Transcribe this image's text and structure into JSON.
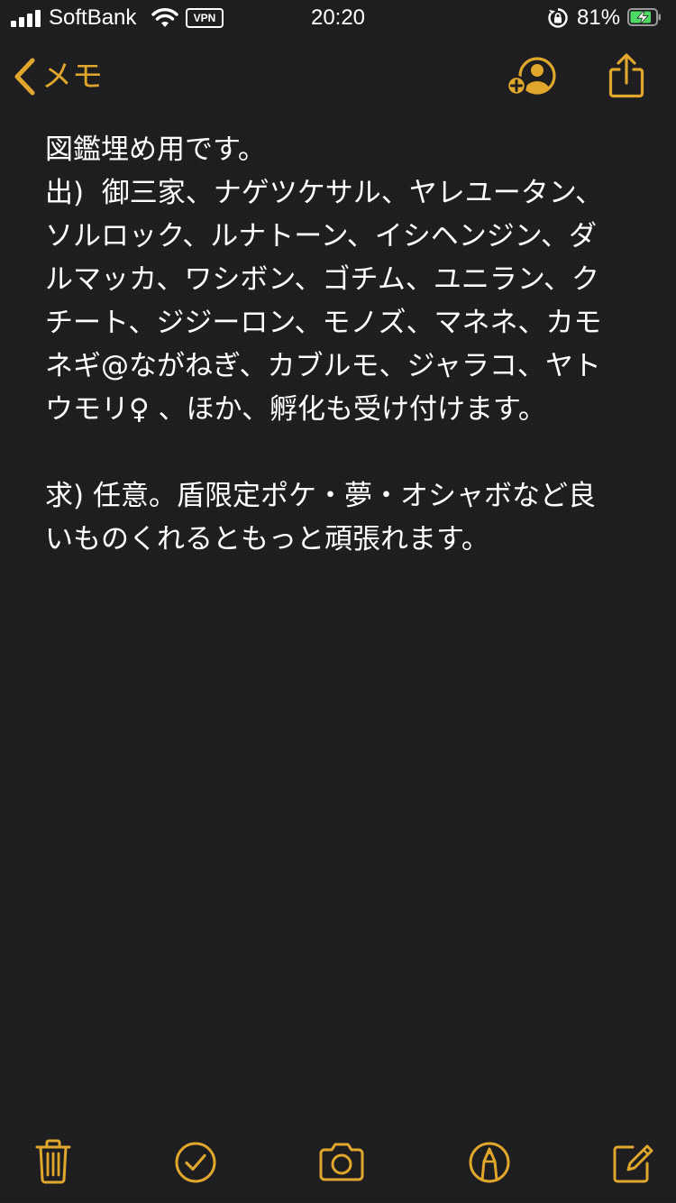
{
  "status_bar": {
    "carrier": "SoftBank",
    "vpn": "VPN",
    "time": "20:20",
    "battery_percent": "81%"
  },
  "nav": {
    "back_label": "メモ",
    "back_icon": "chevron-left-icon",
    "add_person_icon": "add-person-icon",
    "share_icon": "share-icon"
  },
  "note": {
    "lines": [
      "図鑑埋め用です。",
      "出)  御三家、ナゲツケサル、ヤレユータン、",
      "ソルロック、ルナトーン、イシヘンジン、ダ",
      "ルマッカ、ワシボン、ゴチム、ユニラン、ク",
      "チート、ジジーロン、モノズ、マネネ、カモ",
      "ネギ@ながねぎ、カブルモ、ジャラコ、ヤト",
      "ウモリ♀ 、ほか、孵化も受け付けます。",
      "",
      "求) 任意。盾限定ポケ・夢・オシャボなど良",
      "いものくれるともっと頑張れます。"
    ]
  },
  "toolbar": {
    "items": [
      {
        "icon": "trash-icon"
      },
      {
        "icon": "checklist-icon"
      },
      {
        "icon": "camera-icon"
      },
      {
        "icon": "markup-pen-icon"
      },
      {
        "icon": "compose-icon"
      }
    ]
  },
  "colors": {
    "accent": "#e1a72d",
    "background": "#1e1e20",
    "text": "#ffffff",
    "battery_charge": "#4cd964"
  }
}
